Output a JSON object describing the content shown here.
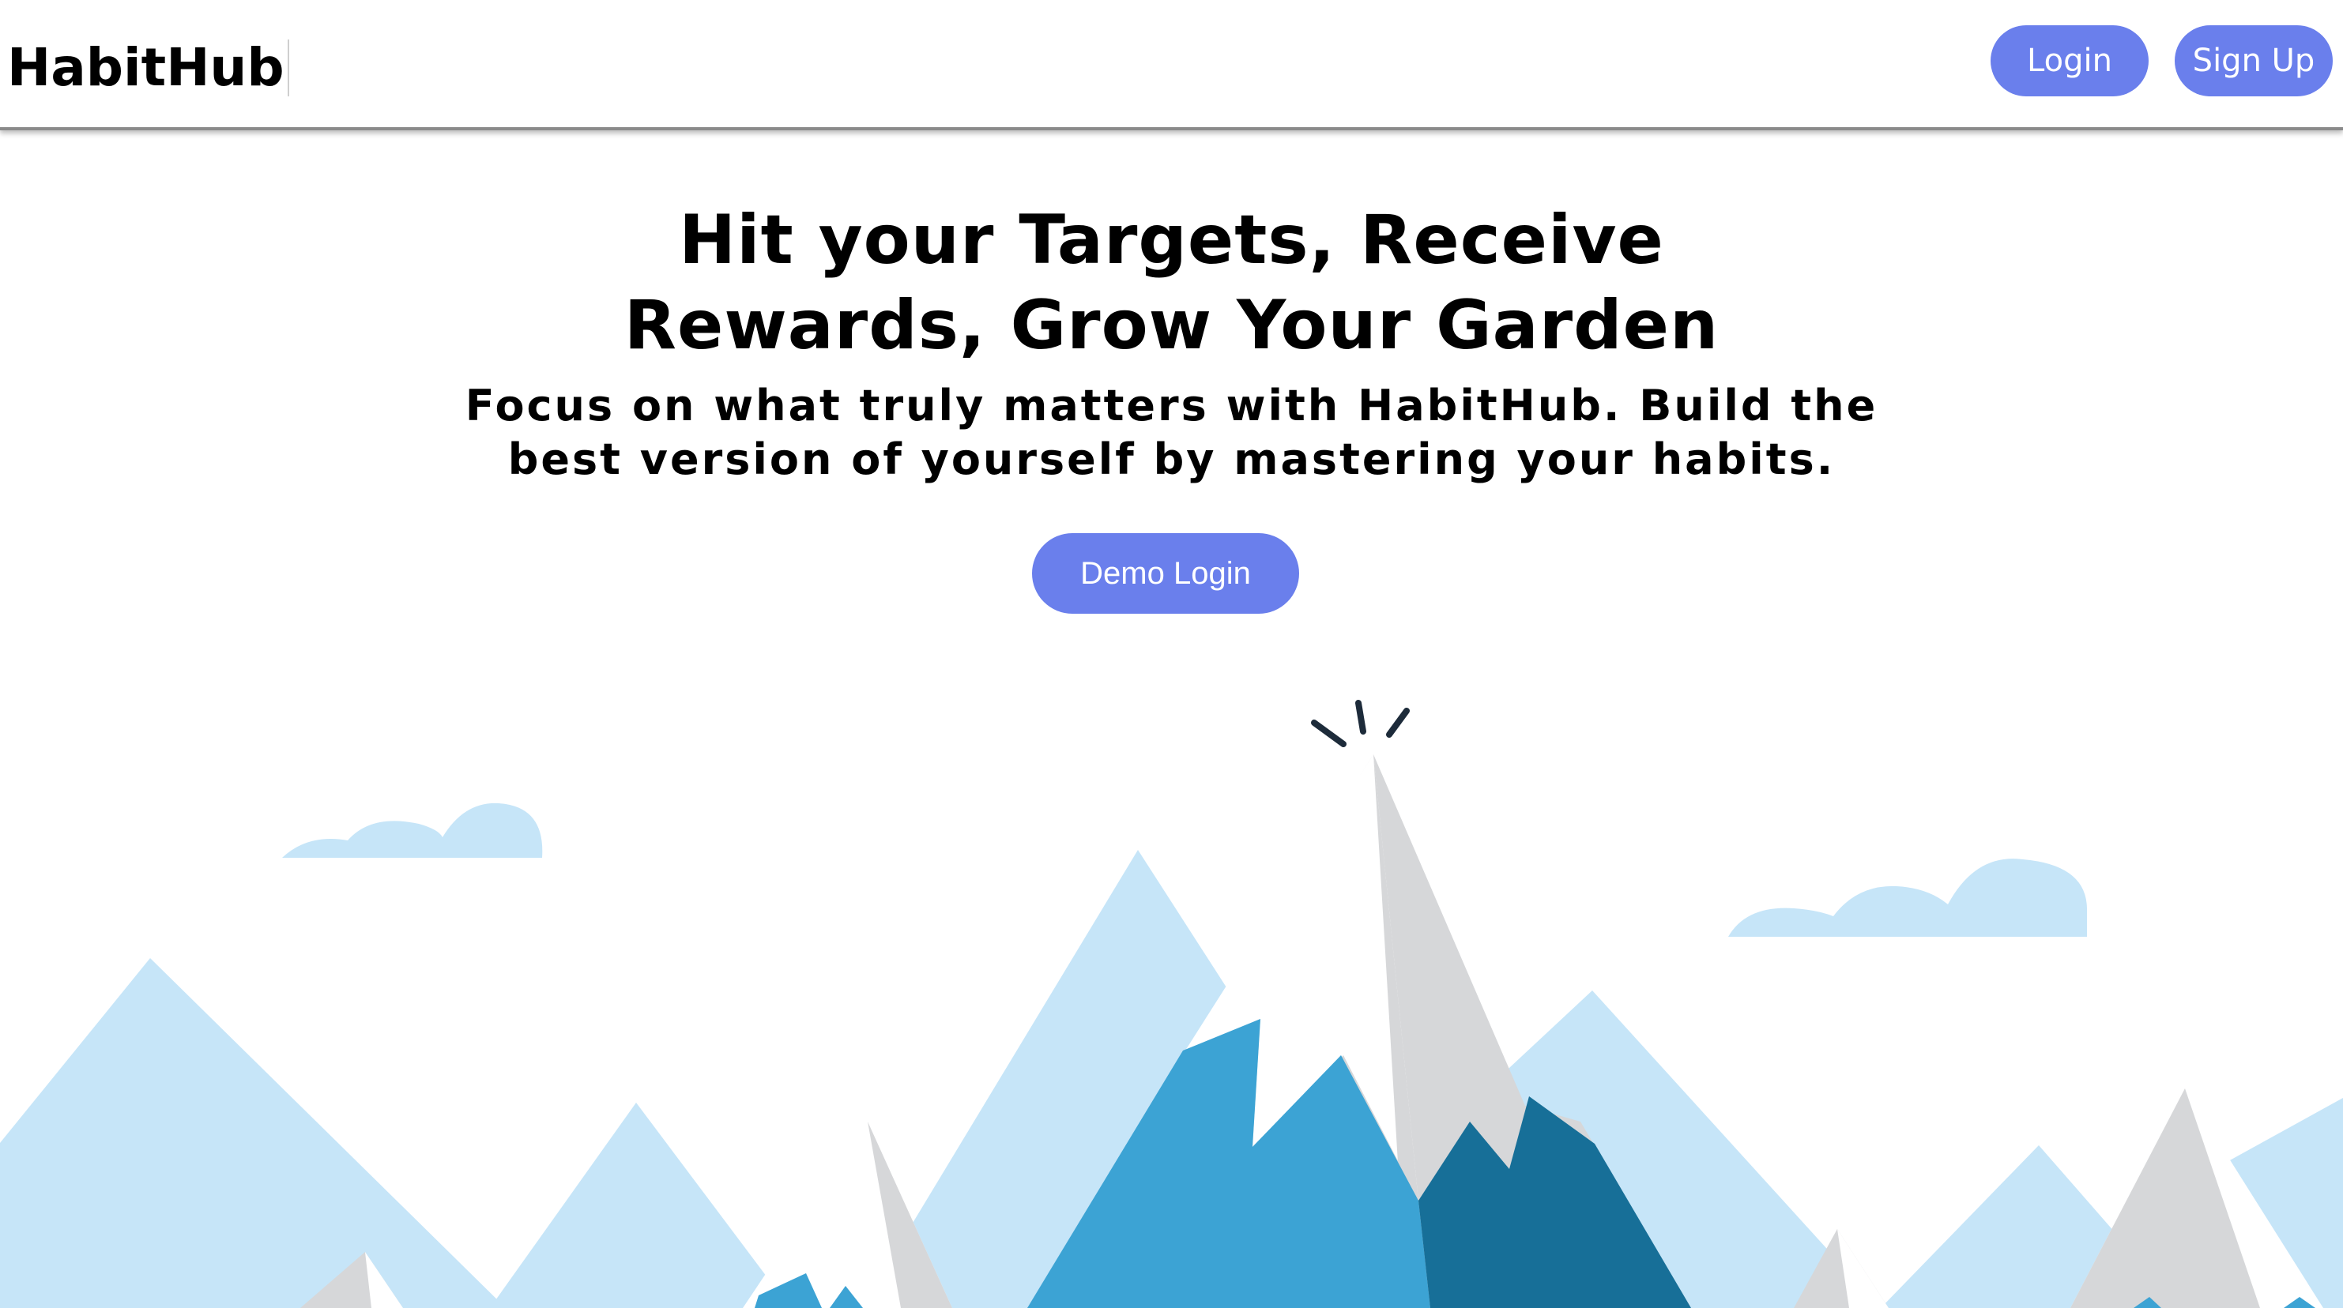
{
  "header": {
    "logo_text": "HabitHub",
    "login_label": "Login",
    "signup_label": "Sign Up"
  },
  "hero": {
    "headline_line1": "Hit your Targets, Receive",
    "headline_line2": "Rewards, Grow Your Garden",
    "subhead_line1": "Focus on what truly matters with HabitHub. Build the",
    "subhead_line2": "best version of yourself by mastering your habits.",
    "demo_login_label": "Demo Login"
  },
  "colors": {
    "accent": "#6a7fec",
    "sky_mountain": "#c6e5f8",
    "mid_blue": "#3ca3d4",
    "dark_blue": "#176f98",
    "snow_gray": "#d6d7d9",
    "cloud": "#c6e5f8"
  }
}
